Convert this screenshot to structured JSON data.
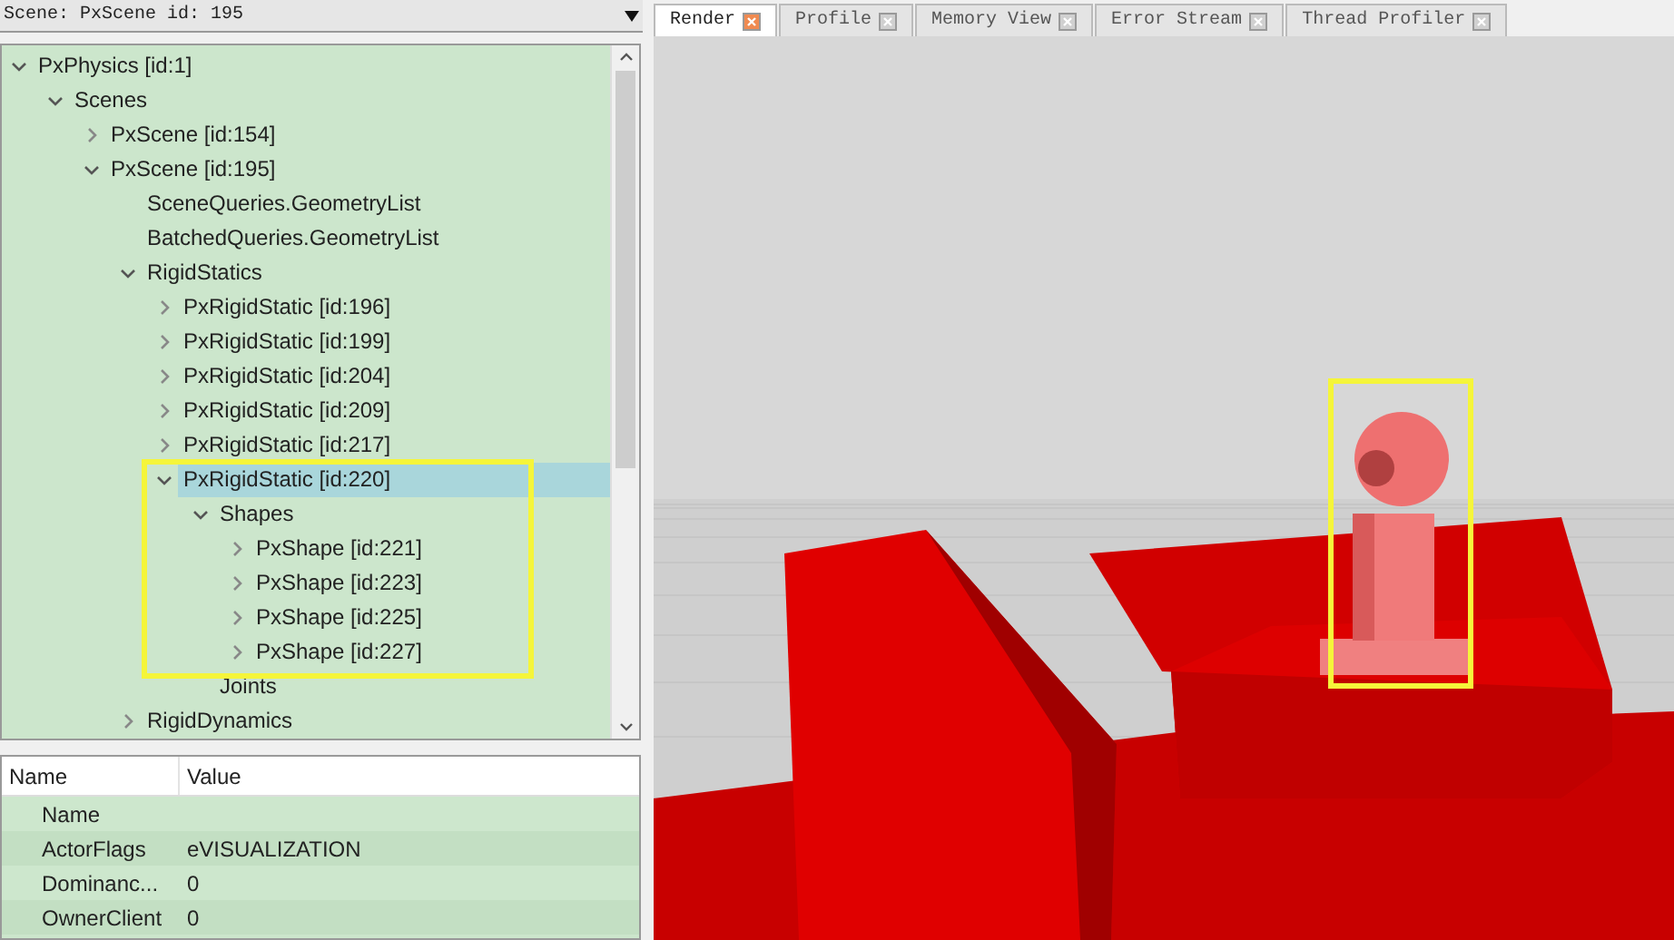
{
  "scene_selector": {
    "value": "Scene: PxScene id: 195"
  },
  "tabs": [
    {
      "label": "Render",
      "selected": true
    },
    {
      "label": "Profile",
      "selected": false
    },
    {
      "label": "Memory View",
      "selected": false
    },
    {
      "label": "Error Stream",
      "selected": false
    },
    {
      "label": "Thread Profiler",
      "selected": false
    }
  ],
  "tree": [
    {
      "label": "PxPhysics [id:1]",
      "expanded": true,
      "selected": false,
      "children": [
        {
          "label": "Scenes",
          "expanded": true,
          "selected": false,
          "children": [
            {
              "label": "PxScene [id:154]",
              "expanded": false,
              "selected": false
            },
            {
              "label": "PxScene [id:195]",
              "expanded": true,
              "selected": false,
              "children": [
                {
                  "label": "SceneQueries.GeometryList",
                  "selected": false
                },
                {
                  "label": "BatchedQueries.GeometryList",
                  "selected": false
                },
                {
                  "label": "RigidStatics",
                  "expanded": true,
                  "selected": false,
                  "children": [
                    {
                      "label": "PxRigidStatic [id:196]",
                      "expanded": false,
                      "selected": false
                    },
                    {
                      "label": "PxRigidStatic [id:199]",
                      "expanded": false,
                      "selected": false
                    },
                    {
                      "label": "PxRigidStatic [id:204]",
                      "expanded": false,
                      "selected": false
                    },
                    {
                      "label": "PxRigidStatic [id:209]",
                      "expanded": false,
                      "selected": false
                    },
                    {
                      "label": "PxRigidStatic [id:217]",
                      "expanded": false,
                      "selected": false
                    },
                    {
                      "label": "PxRigidStatic [id:220]",
                      "expanded": true,
                      "selected": true,
                      "annotated": true,
                      "children": [
                        {
                          "label": "Shapes",
                          "expanded": true,
                          "selected": false,
                          "children": [
                            {
                              "label": "PxShape [id:221]",
                              "expanded": false,
                              "selected": false
                            },
                            {
                              "label": "PxShape [id:223]",
                              "expanded": false,
                              "selected": false
                            },
                            {
                              "label": "PxShape [id:225]",
                              "expanded": false,
                              "selected": false
                            },
                            {
                              "label": "PxShape [id:227]",
                              "expanded": false,
                              "selected": false
                            }
                          ]
                        },
                        {
                          "label": "Joints",
                          "selected": false
                        }
                      ]
                    }
                  ]
                },
                {
                  "label": "RigidDynamics",
                  "expanded": false,
                  "selected": false
                }
              ]
            }
          ]
        }
      ]
    }
  ],
  "properties": {
    "columns": [
      "Name",
      "Value"
    ],
    "rows": [
      {
        "name": "Name"
      },
      {
        "name": "ActorFlags",
        "value": "eVISUALIZATION"
      },
      {
        "name": "Dominanc...",
        "value": "0"
      },
      {
        "name": "OwnerClient",
        "value": "0"
      }
    ]
  }
}
